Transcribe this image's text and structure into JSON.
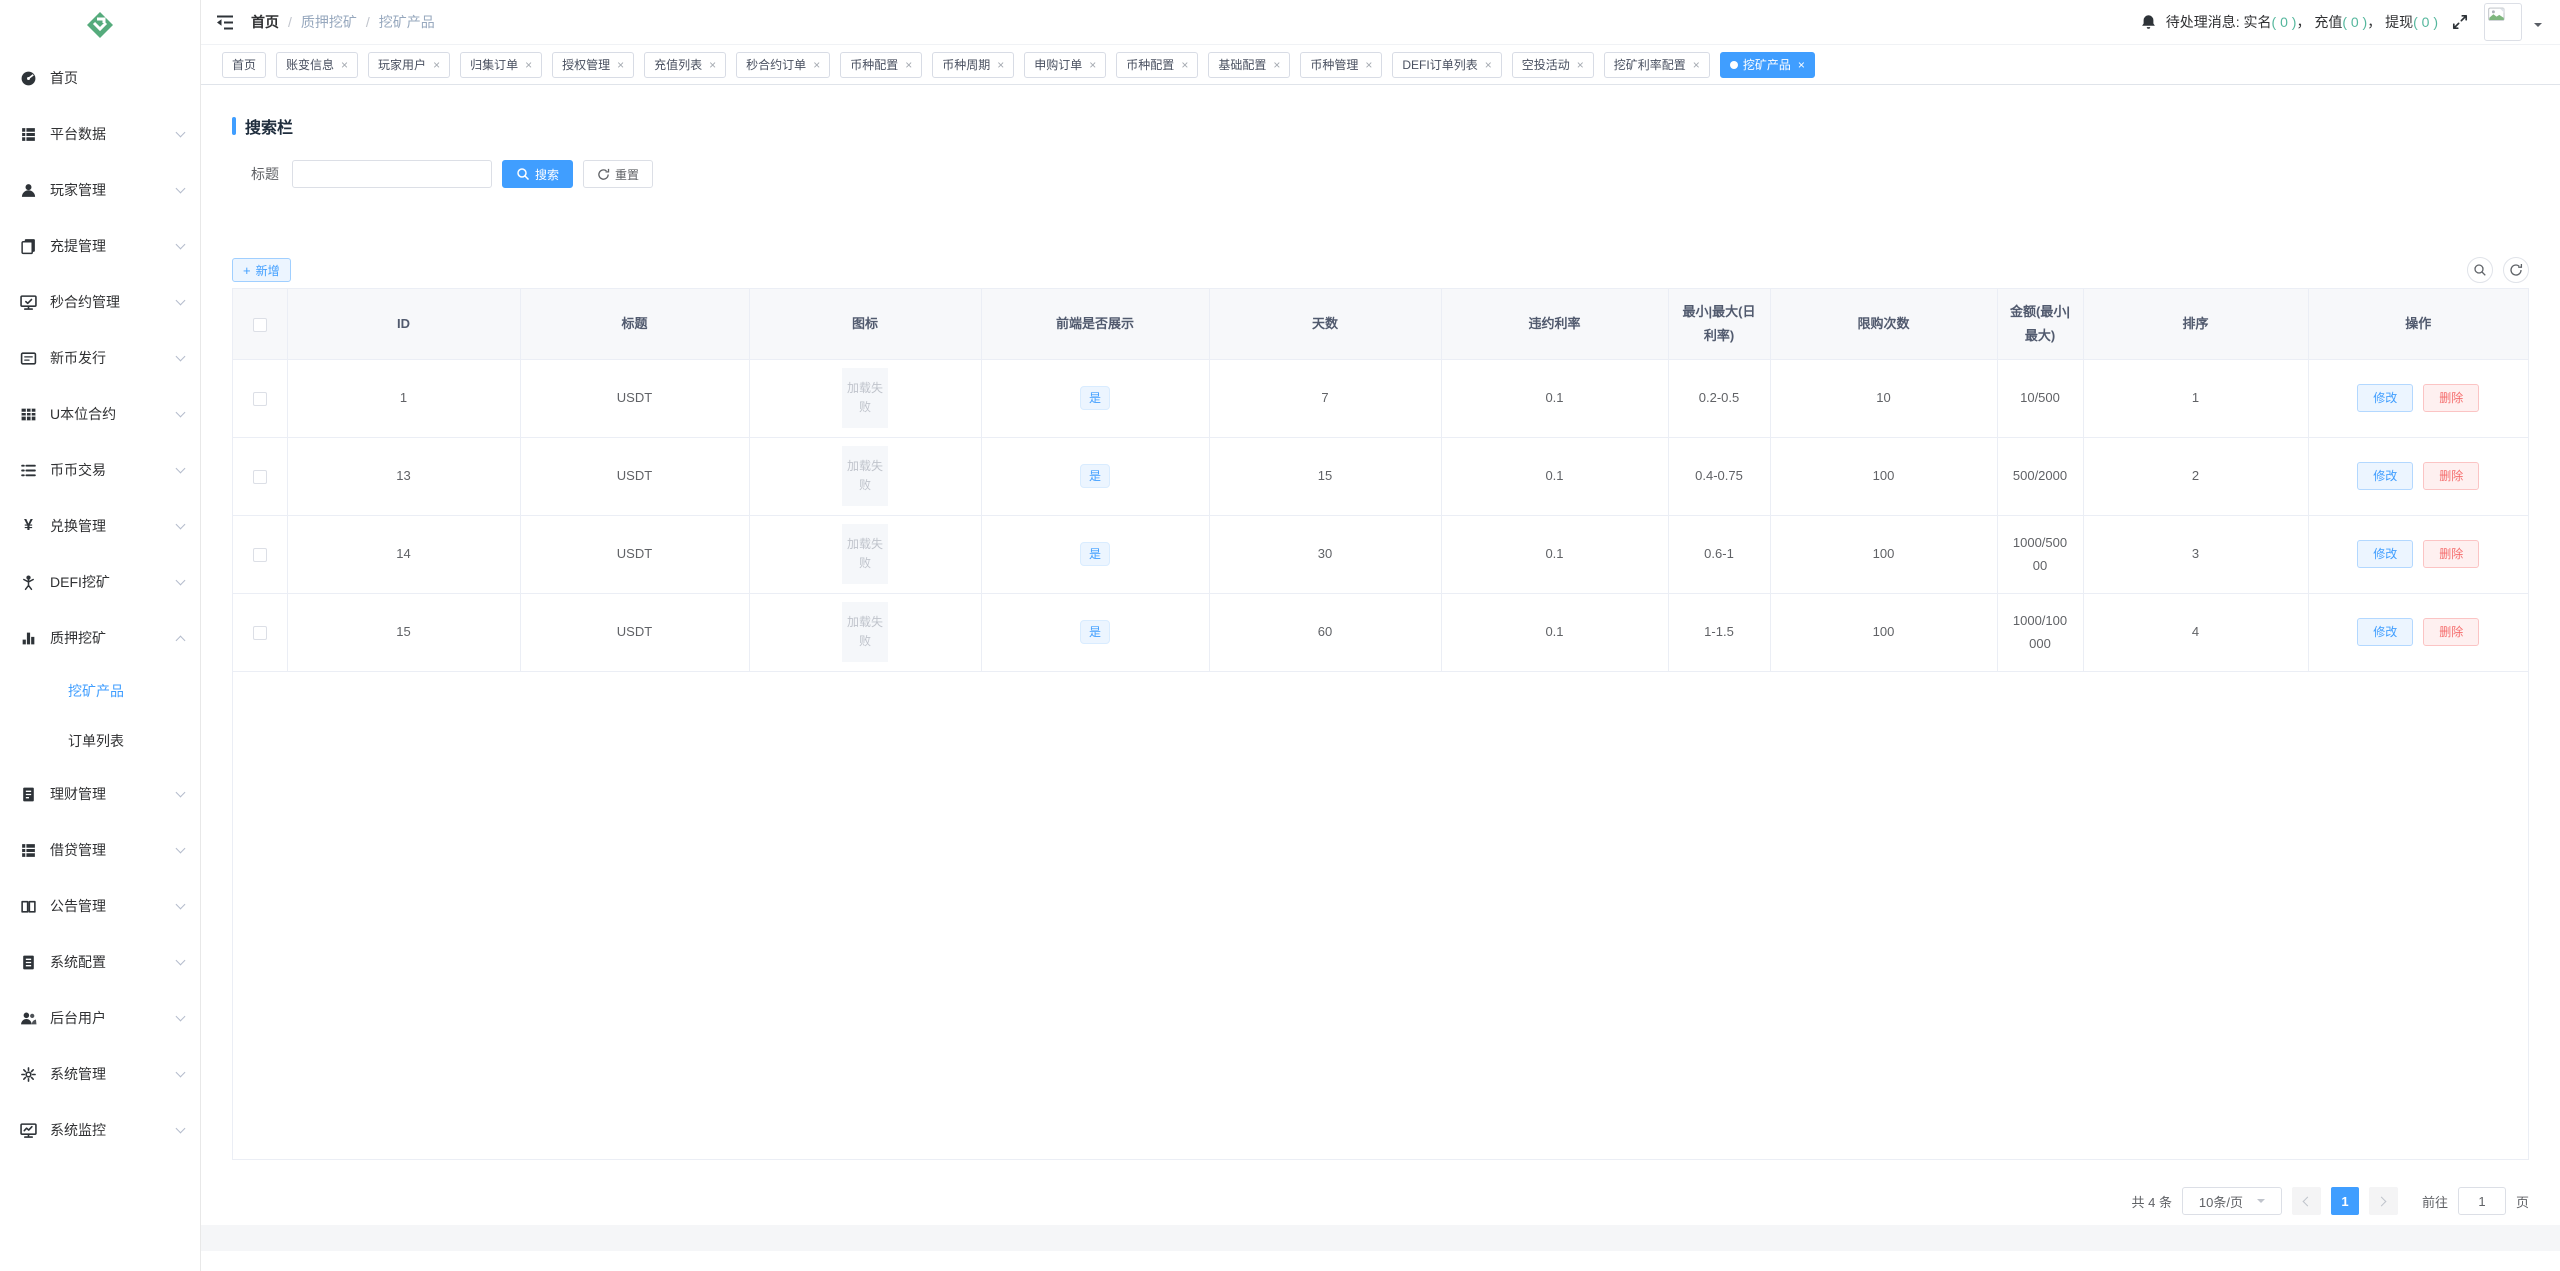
{
  "colors": {
    "accent": "#409eff",
    "danger": "#f56c6c",
    "notice_count": "#55b79d",
    "logo_green": "#55ab7c"
  },
  "sidebar": {
    "items": [
      {
        "label": "首页",
        "icon": "dashboard-icon"
      },
      {
        "label": "平台数据",
        "icon": "platform-data-icon"
      },
      {
        "label": "玩家管理",
        "icon": "player-icon"
      },
      {
        "label": "充提管理",
        "icon": "recharge-withdraw-icon"
      },
      {
        "label": "秒合约管理",
        "icon": "second-contract-icon"
      },
      {
        "label": "新币发行",
        "icon": "new-coin-icon"
      },
      {
        "label": "U本位合约",
        "icon": "u-contract-icon"
      },
      {
        "label": "币币交易",
        "icon": "coin-trade-icon"
      },
      {
        "label": "兑换管理",
        "icon": "exchange-icon"
      },
      {
        "label": "DEFI挖矿",
        "icon": "defi-mining-icon"
      },
      {
        "label": "质押挖矿",
        "icon": "stake-mining-icon",
        "expanded": true,
        "children": [
          {
            "label": "挖矿产品",
            "active": true
          },
          {
            "label": "订单列表",
            "active": false
          }
        ]
      },
      {
        "label": "理财管理",
        "icon": "finance-icon"
      },
      {
        "label": "借贷管理",
        "icon": "lending-icon"
      },
      {
        "label": "公告管理",
        "icon": "notice-icon"
      },
      {
        "label": "系统配置",
        "icon": "system-config-icon"
      },
      {
        "label": "后台用户",
        "icon": "backend-user-icon"
      },
      {
        "label": "系统管理",
        "icon": "system-manage-icon"
      },
      {
        "label": "系统监控",
        "icon": "system-monitor-icon"
      }
    ]
  },
  "breadcrumb": {
    "separator": "/",
    "items": [
      "首页",
      "质押挖矿",
      "挖矿产品"
    ]
  },
  "notice": {
    "prefix": "待处理消息:",
    "sep": "，",
    "items": [
      {
        "label": "实名",
        "count": "( 0 )"
      },
      {
        "label": "充值",
        "count": "( 0 )"
      },
      {
        "label": "提现",
        "count": "( 0 )"
      }
    ]
  },
  "tabs": [
    {
      "label": "首页",
      "closable": false,
      "active": false
    },
    {
      "label": "账变信息",
      "closable": true,
      "active": false
    },
    {
      "label": "玩家用户",
      "closable": true,
      "active": false
    },
    {
      "label": "归集订单",
      "closable": true,
      "active": false
    },
    {
      "label": "授权管理",
      "closable": true,
      "active": false
    },
    {
      "label": "充值列表",
      "closable": true,
      "active": false
    },
    {
      "label": "秒合约订单",
      "closable": true,
      "active": false
    },
    {
      "label": "币种配置",
      "closable": true,
      "active": false
    },
    {
      "label": "币种周期",
      "closable": true,
      "active": false
    },
    {
      "label": "申购订单",
      "closable": true,
      "active": false
    },
    {
      "label": "币种配置",
      "closable": true,
      "active": false
    },
    {
      "label": "基础配置",
      "closable": true,
      "active": false
    },
    {
      "label": "币种管理",
      "closable": true,
      "active": false
    },
    {
      "label": "DEFI订单列表",
      "closable": true,
      "active": false
    },
    {
      "label": "空投活动",
      "closable": true,
      "active": false
    },
    {
      "label": "挖矿利率配置",
      "closable": true,
      "active": false
    },
    {
      "label": "挖矿产品",
      "closable": true,
      "active": true
    }
  ],
  "search": {
    "title": "搜索栏",
    "label": "标题",
    "input_value": "",
    "search": "搜索",
    "reset": "重置"
  },
  "toolbar": {
    "add": "新增"
  },
  "table": {
    "headers": [
      "ID",
      "标题",
      "图标",
      "前端是否展示",
      "天数",
      "违约利率",
      "最小|最大(日利率)",
      "限购次数",
      "金额(最小|最大)",
      "排序",
      "操作"
    ],
    "icon_placeholder": "加载失败",
    "display_tag": "是",
    "edit": "修改",
    "delete": "删除",
    "rows": [
      {
        "id": "1",
        "title": "USDT",
        "days": "7",
        "rate": "0.1",
        "min_max_daily": "0.2-0.5",
        "limit": "10",
        "amount": "10/500",
        "sort": "1"
      },
      {
        "id": "13",
        "title": "USDT",
        "days": "15",
        "rate": "0.1",
        "min_max_daily": "0.4-0.75",
        "limit": "100",
        "amount": "500/2000",
        "sort": "2"
      },
      {
        "id": "14",
        "title": "USDT",
        "days": "30",
        "rate": "0.1",
        "min_max_daily": "0.6-1",
        "limit": "100",
        "amount": "1000/50000",
        "sort": "3"
      },
      {
        "id": "15",
        "title": "USDT",
        "days": "60",
        "rate": "0.1",
        "min_max_daily": "1-1.5",
        "limit": "100",
        "amount": "1000/100000",
        "sort": "4"
      }
    ]
  },
  "pagination": {
    "total": "共 4 条",
    "page_size": "10条/页",
    "current": "1",
    "goto": "前往",
    "unit": "页",
    "goto_value": "1"
  }
}
